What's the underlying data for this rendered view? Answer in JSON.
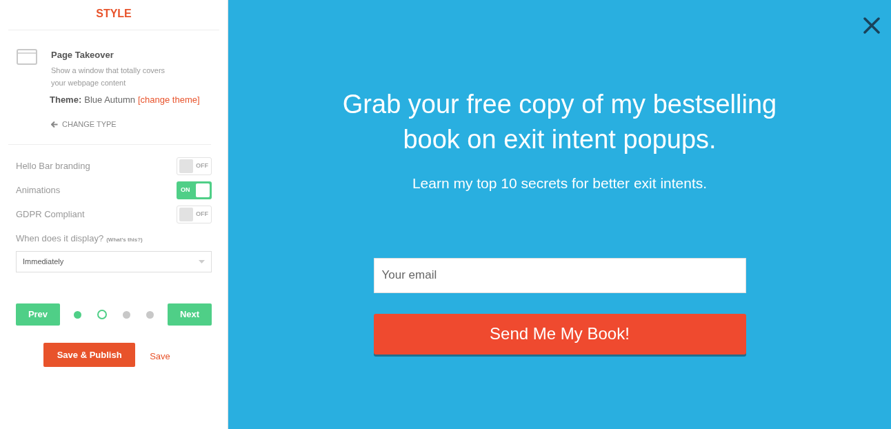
{
  "sidebar": {
    "title": "STYLE",
    "type": {
      "name": "Page Takeover",
      "description": "Show a window that totally covers your webpage content",
      "theme_label": "Theme:",
      "theme": "Blue Autumn",
      "theme_link": "[change theme]",
      "change_type": "CHANGE TYPE"
    },
    "toggles": [
      {
        "label": "Hello Bar branding",
        "on": false,
        "text": "OFF"
      },
      {
        "label": "Animations",
        "on": true,
        "text": "ON"
      },
      {
        "label": "GDPR Compliant",
        "on": false,
        "text": "OFF"
      }
    ],
    "display": {
      "label": "When does it display?",
      "help": "(What's this?)",
      "value": "Immediately"
    },
    "steps": [
      {
        "done": true,
        "selected": false
      },
      {
        "done": false,
        "selected": true
      },
      {
        "done": false,
        "selected": false
      },
      {
        "done": false,
        "selected": false
      }
    ],
    "prev": "Prev",
    "next": "Next",
    "publish": "Save & Publish",
    "save": "Save"
  },
  "preview": {
    "headline": "Grab your free copy of my bestselling book on exit intent popups.",
    "subheadline": "Learn my top 10 secrets for better exit intents.",
    "email_placeholder": "Your email",
    "cta": "Send Me My Book!"
  }
}
